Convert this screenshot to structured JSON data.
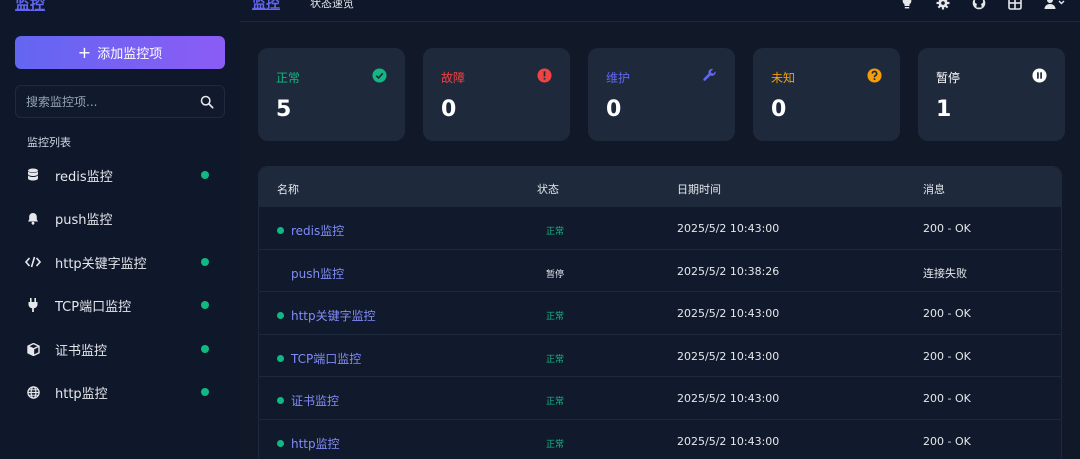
{
  "sidebar": {
    "brand": "监控",
    "add_button": "添加监控项",
    "search_placeholder": "搜索监控项...",
    "list_title": "监控列表",
    "items": [
      {
        "label": "redis监控",
        "icon": "database-icon",
        "active": true
      },
      {
        "label": "push监控",
        "icon": "bell-icon",
        "active": false
      },
      {
        "label": "http关键字监控",
        "icon": "code-icon",
        "active": true
      },
      {
        "label": "TCP端口监控",
        "icon": "plug-icon",
        "active": true
      },
      {
        "label": "证书监控",
        "icon": "cube-icon",
        "active": true
      },
      {
        "label": "http监控",
        "icon": "globe-icon",
        "active": true
      }
    ]
  },
  "topbar": {
    "brand": "监控",
    "subtitle": "状态速览",
    "icons": [
      "lightbulb-icon",
      "gear-icon",
      "github-icon",
      "grid-icon",
      "user-icon"
    ]
  },
  "cards": [
    {
      "label": "正常",
      "value": "5",
      "color": "#10b981",
      "icon": "check-circle-icon"
    },
    {
      "label": "故障",
      "value": "0",
      "color": "#ef4444",
      "icon": "alert-circle-icon"
    },
    {
      "label": "维护",
      "value": "0",
      "color": "#6366f1",
      "icon": "wrench-icon"
    },
    {
      "label": "未知",
      "value": "0",
      "color": "#f59e0b",
      "icon": "question-circle-icon"
    },
    {
      "label": "暂停",
      "value": "1",
      "color": "#ffffff",
      "icon": "pause-circle-icon"
    }
  ],
  "table": {
    "columns": [
      "名称",
      "状态",
      "日期时间",
      "消息"
    ],
    "rows": [
      {
        "name": "redis监控",
        "status": "正常",
        "time": "2025/5/2 10:43:00",
        "message": "200 - OK",
        "up": true
      },
      {
        "name": "push监控",
        "status": "暂停",
        "time": "2025/5/2 10:38:26",
        "message": "连接失败",
        "up": false
      },
      {
        "name": "http关键字监控",
        "status": "正常",
        "time": "2025/5/2 10:43:00",
        "message": "200 - OK",
        "up": true
      },
      {
        "name": "TCP端口监控",
        "status": "正常",
        "time": "2025/5/2 10:43:00",
        "message": "200 - OK",
        "up": true
      },
      {
        "name": "证书监控",
        "status": "正常",
        "time": "2025/5/2 10:43:00",
        "message": "200 - OK",
        "up": true
      },
      {
        "name": "http监控",
        "status": "正常",
        "time": "2025/5/2 10:43:00",
        "message": "200 - OK",
        "up": true
      }
    ]
  }
}
